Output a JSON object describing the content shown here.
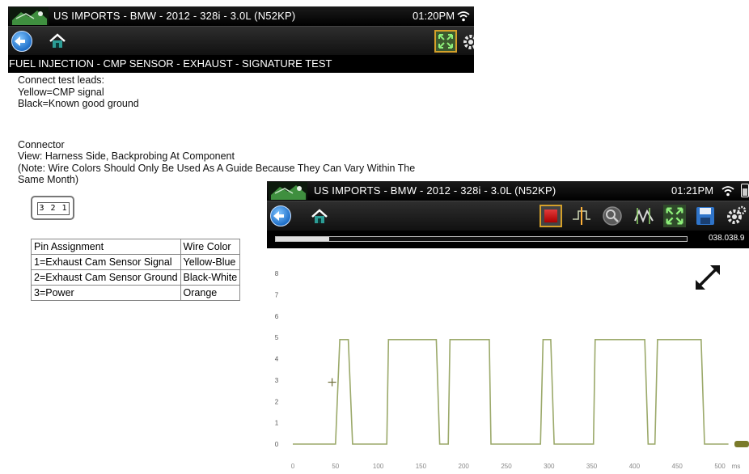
{
  "screen1": {
    "title": "US IMPORTS - BMW - 2012 - 328i - 3.0L (N52KP)",
    "time": "01:20PM",
    "breadcrumb": "FUEL INJECTION - CMP SENSOR - EXHAUST - SIGNATURE TEST",
    "instructions": [
      "Connect test leads:",
      "Yellow=CMP signal",
      "Black=Known good ground"
    ],
    "connector": [
      "Connector",
      "View: Harness Side, Backprobing At Component",
      "(Note: Wire Colors Should Only Be Used As A Guide Because They Can Vary Within The",
      "Same Month)"
    ],
    "connector_pins_label": "3 2 1",
    "table": {
      "headers": [
        "Pin Assignment",
        "Wire Color"
      ],
      "rows": [
        [
          "1=Exhaust Cam Sensor Signal",
          "Yellow-Blue"
        ],
        [
          "2=Exhaust Cam Sensor Ground",
          "Black-White"
        ],
        [
          "3=Power",
          "Orange"
        ]
      ]
    }
  },
  "screen2": {
    "title": "US IMPORTS - BMW - 2012 - 328i - 3.0L (N52KP)",
    "time": "01:21PM",
    "counter": "038.038.9",
    "buffer_progress_fraction": 0.13
  },
  "icons": {
    "back": "back-arrow-icon",
    "home": "home-icon",
    "zoom": "zoom-fit-icon",
    "settings": "gear-icon",
    "record": "record-stop-icon",
    "trigger": "trigger-icon",
    "magnify": "magnify-icon",
    "cursors": "cursor-icon",
    "save": "save-icon",
    "expand": "expand-icon",
    "wifi": "wifi-icon",
    "battery": "battery-icon"
  },
  "colors": {
    "trace": "#9ba96a",
    "accent_border": "#d4a02a",
    "bar_black": "#000000"
  },
  "chart_data": {
    "type": "line",
    "title": "",
    "xlabel": "",
    "ylabel": "",
    "x_unit": "ms",
    "xlim": [
      0,
      500
    ],
    "ylim": [
      0,
      8
    ],
    "x_ticks": [
      0,
      50,
      100,
      150,
      200,
      250,
      300,
      350,
      400,
      450,
      500
    ],
    "y_ticks": [
      0,
      1,
      2,
      3,
      4,
      5,
      6,
      7,
      8
    ],
    "cursor_marker": {
      "x": 46,
      "y": 2.9
    },
    "series": [
      {
        "x": [
          0,
          50,
          55,
          65,
          70,
          110,
          112,
          168,
          172,
          182,
          184,
          192,
          196,
          230,
          232,
          290,
          293,
          302,
          306,
          352,
          354,
          412,
          416,
          424,
          427,
          478,
          482,
          510
        ],
        "y": [
          0,
          0,
          4.9,
          4.9,
          0,
          0,
          4.9,
          4.9,
          0,
          0,
          4.9,
          4.9,
          4.9,
          4.9,
          0,
          0,
          4.9,
          4.9,
          0,
          0,
          4.9,
          4.9,
          0,
          0,
          4.9,
          4.9,
          0,
          0
        ]
      }
    ]
  }
}
